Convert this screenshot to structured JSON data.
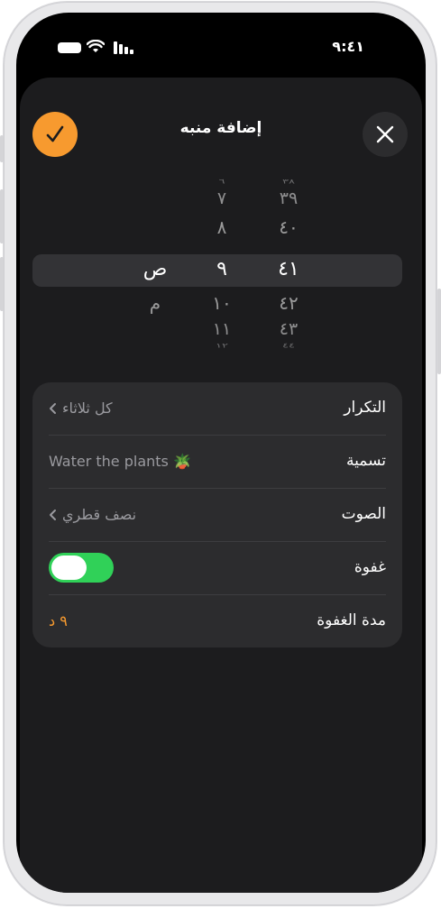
{
  "status": {
    "time": "٩:٤١"
  },
  "header": {
    "title": "إضافة منبه"
  },
  "picker": {
    "minutes": [
      "٣٨",
      "٣٩",
      "٤٠",
      "٤١",
      "٤٢",
      "٤٣",
      "٤٤"
    ],
    "hours": [
      "٦",
      "٧",
      "٨",
      "٩",
      "١٠",
      "١١",
      "١٢"
    ],
    "ampm": [
      "ص",
      "م"
    ]
  },
  "settings": {
    "repeat": {
      "label": "التكرار",
      "value": "كل ثلاثاء"
    },
    "name": {
      "label": "تسمية",
      "value": "Water the plants 🪴"
    },
    "sound": {
      "label": "الصوت",
      "value": "نصف قطري"
    },
    "snooze": {
      "label": "غفوة",
      "on": true
    },
    "snooze_duration": {
      "label": "مدة الغفوة",
      "value": "٩ د"
    }
  },
  "colors": {
    "accent": "#f79a2f",
    "toggle_on": "#30d158"
  }
}
